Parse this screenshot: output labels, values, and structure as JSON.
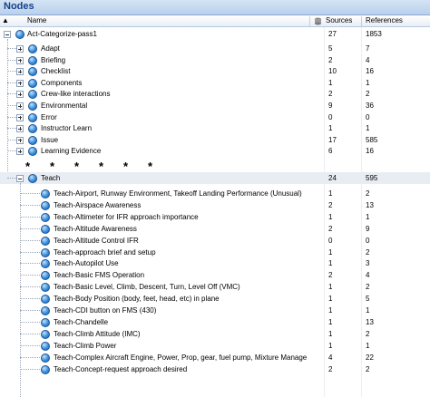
{
  "panel": {
    "title": "Nodes"
  },
  "columns": {
    "name": "Name",
    "sources": "Sources",
    "references": "References"
  },
  "root": {
    "label": "Act-Categorize-pass1",
    "sources": "27",
    "references": "1853"
  },
  "children": [
    {
      "label": "Adapt",
      "sources": "5",
      "references": "7"
    },
    {
      "label": "Briefing",
      "sources": "2",
      "references": "4"
    },
    {
      "label": "Checklist",
      "sources": "10",
      "references": "16"
    },
    {
      "label": "Components",
      "sources": "1",
      "references": "1"
    },
    {
      "label": "Crew-like interactions",
      "sources": "2",
      "references": "2"
    },
    {
      "label": "Environmental",
      "sources": "9",
      "references": "36"
    },
    {
      "label": "Error",
      "sources": "0",
      "references": "0"
    },
    {
      "label": "Instructor Learn",
      "sources": "1",
      "references": "1"
    },
    {
      "label": "Issue",
      "sources": "17",
      "references": "585"
    },
    {
      "label": "Learning Evidence",
      "sources": "6",
      "references": "16"
    }
  ],
  "ellipsis": "* * * * * *",
  "teach": {
    "label": "Teach",
    "sources": "24",
    "references": "595"
  },
  "teach_children": [
    {
      "label": "Teach-Airport, Runway Environment, Takeoff Landing Performance (Unusual)",
      "sources": "1",
      "references": "2"
    },
    {
      "label": "Teach-Airspace Awareness",
      "sources": "2",
      "references": "13"
    },
    {
      "label": "Teach-Altimeter for IFR approach importance",
      "sources": "1",
      "references": "1"
    },
    {
      "label": "Teach-Altitude Awareness",
      "sources": "2",
      "references": "9"
    },
    {
      "label": "Teach-Altitude Control IFR",
      "sources": "0",
      "references": "0"
    },
    {
      "label": "Teach-approach brief and setup",
      "sources": "1",
      "references": "2"
    },
    {
      "label": "Teach-Autopilot Use",
      "sources": "1",
      "references": "3"
    },
    {
      "label": "Teach-Basic FMS Operation",
      "sources": "2",
      "references": "4"
    },
    {
      "label": "Teach-Basic Level, Climb, Descent, Turn, Level Off (VMC)",
      "sources": "1",
      "references": "2"
    },
    {
      "label": "Teach-Body Position (body, feet, head, etc) in plane",
      "sources": "1",
      "references": "5"
    },
    {
      "label": "Teach-CDI button on FMS (430)",
      "sources": "1",
      "references": "1"
    },
    {
      "label": "Teach-Chandelle",
      "sources": "1",
      "references": "13"
    },
    {
      "label": "Teach-Climb Attitude (IMC)",
      "sources": "1",
      "references": "2"
    },
    {
      "label": "Teach-Climb Power",
      "sources": "1",
      "references": "1"
    },
    {
      "label": "Teach-Complex Aircraft Engine, Power, Prop, gear, fuel pump, Mixture Manage",
      "sources": "4",
      "references": "22"
    },
    {
      "label": "Teach-Concept-request approach desired",
      "sources": "2",
      "references": "2"
    }
  ]
}
